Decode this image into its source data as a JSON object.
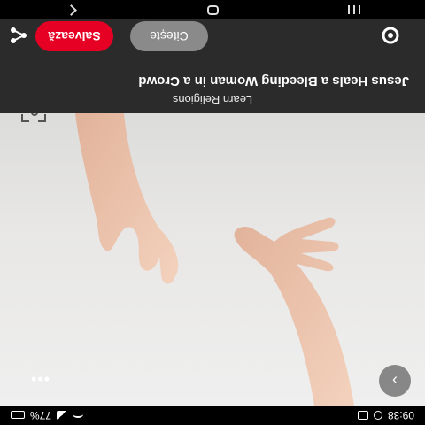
{
  "status_bar": {
    "time": "09:38",
    "battery": "77%"
  },
  "pin": {
    "source": "Learn Religions",
    "title": "Jesus Heals a Bleeding Woman in a Crowd"
  },
  "actions": {
    "read_label": "Citește",
    "save_label": "Salvează"
  },
  "colors": {
    "save_button": "#e60023",
    "read_button": "#8a8a8a",
    "panel": "#2b2b2b"
  },
  "icons": {
    "share": "share-icon",
    "options": "more-icon",
    "lens": "visual-search-icon",
    "next": "chevron-right-icon",
    "menu": "ellipsis-icon"
  }
}
